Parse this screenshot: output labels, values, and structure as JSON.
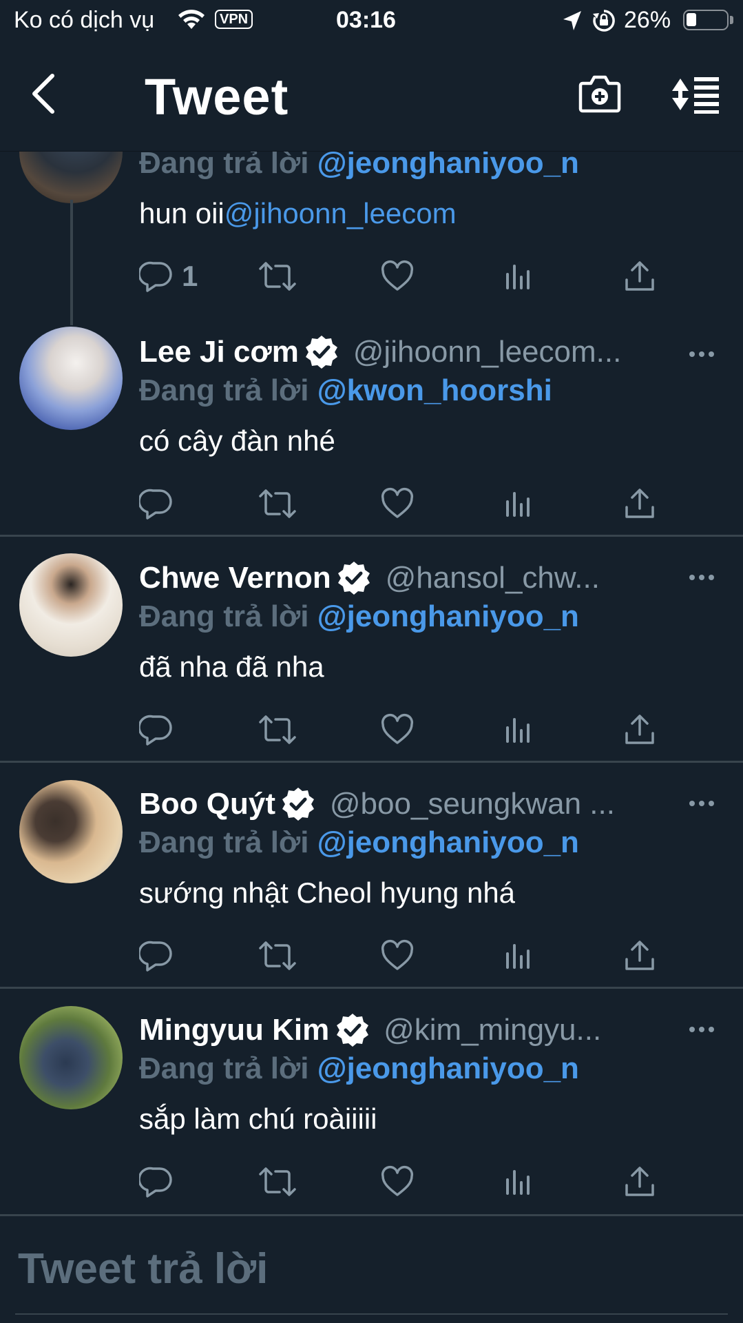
{
  "status_bar": {
    "carrier": "Ko có dịch vụ",
    "vpn": "VPN",
    "time": "03:16",
    "battery": "26%",
    "battery_level": 0.26
  },
  "header": {
    "title": "Tweet"
  },
  "colors": {
    "background": "#15202b",
    "accent": "#4a99e9",
    "muted": "#8899a6",
    "divider": "#38444d"
  },
  "thread": {
    "previous_tweet": {
      "reply_prefix": "Đang trả lời",
      "reply_to": "@jeonghaniyoo_n",
      "text_prefix": "hun oii",
      "text_mention": "@jihoonn_leecom",
      "reply_count": "1"
    },
    "replies": [
      {
        "name": "Lee Ji cơm",
        "handle": "@jihoonn_leecom...",
        "reply_prefix": "Đang trả lời",
        "reply_to": "@kwon_hoorshi",
        "text": "có cây đàn nhé"
      },
      {
        "name": "Chwe Vernon",
        "handle": "@hansol_chw...",
        "reply_prefix": "Đang trả lời",
        "reply_to": "@jeonghaniyoo_n",
        "text": "đã nha đã nha"
      },
      {
        "name": "Boo Quýt",
        "handle": "@boo_seungkwan ...",
        "reply_prefix": "Đang trả lời",
        "reply_to": "@jeonghaniyoo_n",
        "text": "sướng nhật Cheol hyung nhá"
      },
      {
        "name": "Mingyuu Kim",
        "handle": "@kim_mingyu...",
        "reply_prefix": "Đang trả lời",
        "reply_to": "@jeonghaniyoo_n",
        "text": "sắp làm chú roàiiiii"
      }
    ]
  },
  "compose": {
    "placeholder": "Tweet trả lời"
  }
}
